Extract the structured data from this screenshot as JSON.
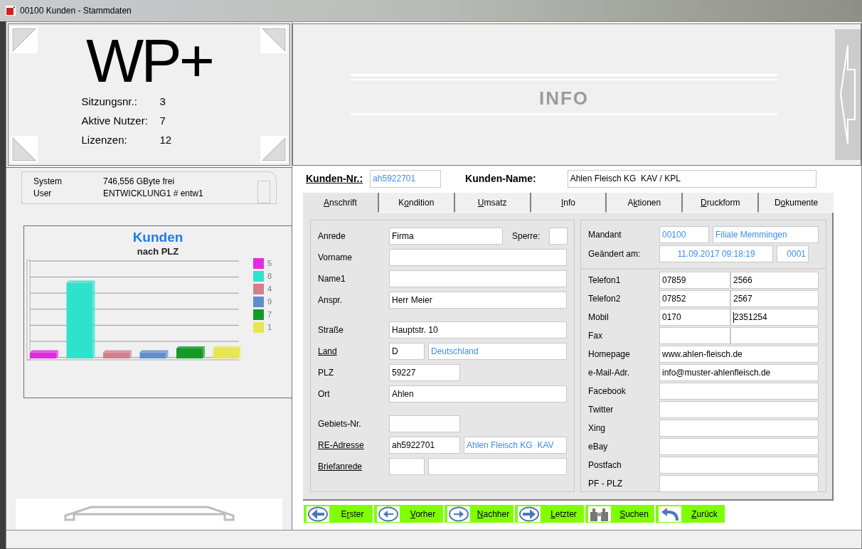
{
  "window": {
    "title": "00100 Kunden - Stammdaten"
  },
  "logo": {
    "text": "WP+",
    "stats": [
      {
        "label": "Sitzungsnr.:",
        "value": "3"
      },
      {
        "label": "Aktive Nutzer:",
        "value": "7"
      },
      {
        "label": "Lizenzen:",
        "value": "12"
      }
    ]
  },
  "system_info": [
    {
      "label": "System",
      "value": "746,556 GByte frei"
    },
    {
      "label": "User",
      "value": "ENTWICKLUNG1 # entw1"
    }
  ],
  "chart": {
    "title": "Kunden",
    "subtitle": "nach PLZ",
    "legend": [
      {
        "label": "5",
        "color": "#e628e6"
      },
      {
        "label": "8",
        "color": "#2ee3cc"
      },
      {
        "label": "4",
        "color": "#d17f8f"
      },
      {
        "label": "9",
        "color": "#5f8fcb"
      },
      {
        "label": "7",
        "color": "#159a2a"
      },
      {
        "label": "1",
        "color": "#e6e64f"
      }
    ]
  },
  "info_banner": {
    "text": "INFO"
  },
  "header": {
    "number_label": "Kunden-Nr.:",
    "number": "ah5922701",
    "name_label": "Kunden-Name:",
    "name": "Ahlen Fleisch KG  KAV / KPL"
  },
  "tabs": [
    {
      "label": "Anschrift",
      "selected": true
    },
    {
      "label": "Kondition",
      "selected": false
    },
    {
      "label": "Umsatz",
      "selected": false
    },
    {
      "label": "Info",
      "selected": false
    },
    {
      "label": "Aktionen",
      "selected": false
    },
    {
      "label": "Druckform",
      "selected": false
    },
    {
      "label": "Dokumente",
      "selected": false
    }
  ],
  "address_rows": [
    {
      "label": "Anrede",
      "link": false,
      "fields": [
        {
          "kind": "medium",
          "value": "Firma"
        },
        {
          "kind": "label",
          "text": "Sperre:"
        },
        {
          "kind": "check",
          "checked": false
        }
      ]
    },
    {
      "label": "Vorname",
      "link": false,
      "fields": [
        {
          "kind": "full"
        }
      ]
    },
    {
      "label": "Name1",
      "link": false,
      "fields": [
        {
          "kind": "full"
        }
      ]
    },
    {
      "label": "Anspr.",
      "link": false,
      "fields": [
        {
          "kind": "full",
          "value": "Herr Meier"
        }
      ]
    },
    {
      "label": "Straße",
      "link": false,
      "fields": [
        {
          "kind": "full",
          "value": "Hauptstr. 10"
        }
      ]
    },
    {
      "label": "Land",
      "link": true,
      "fields": [
        {
          "kind": "tiny",
          "value": "D"
        },
        {
          "kind": "rest",
          "value": "Deutschland",
          "readonly": true
        }
      ]
    },
    {
      "label": "PLZ",
      "link": false,
      "fields": [
        {
          "kind": "short",
          "value": "59227"
        }
      ]
    },
    {
      "label": "Ort",
      "link": false,
      "fields": [
        {
          "kind": "full",
          "value": "Ahlen"
        }
      ]
    },
    {
      "label": "Gebiets-Nr.",
      "link": false,
      "fields": [
        {
          "kind": "short"
        }
      ]
    },
    {
      "label": "RE-Adresse",
      "link": true,
      "fields": [
        {
          "kind": "short",
          "value": "ah5922701"
        },
        {
          "kind": "rest",
          "value": "Ahlen Fleisch KG  KAV",
          "readonly": true
        }
      ]
    },
    {
      "label": "Briefanrede",
      "link": true,
      "fields": [
        {
          "kind": "tiny"
        },
        {
          "kind": "rest"
        }
      ]
    }
  ],
  "meta_rows": [
    {
      "label": "Mandant",
      "fields": [
        {
          "kind": "code",
          "value": "00100",
          "readonly": true
        },
        {
          "kind": "rest",
          "value": "Filiale Memmingen",
          "readonly": true
        }
      ]
    },
    {
      "label": "Geändert am:",
      "fields": [
        {
          "kind": "date",
          "value": "11.09.2017 09:18:19",
          "readonly": true
        },
        {
          "kind": "counter",
          "value": "0001",
          "readonly": true
        }
      ]
    }
  ],
  "contact_rows": [
    {
      "label": "Telefon1",
      "fields": [
        {
          "kind": "area",
          "value": "07859"
        },
        {
          "kind": "rest",
          "value": "2566"
        }
      ]
    },
    {
      "label": "Telefon2",
      "fields": [
        {
          "kind": "area",
          "value": "07852"
        },
        {
          "kind": "rest",
          "value": "2567"
        }
      ]
    },
    {
      "label": "Mobil",
      "fields": [
        {
          "kind": "area",
          "value": "0170"
        },
        {
          "kind": "rest",
          "value": "2351254",
          "focused": true
        }
      ]
    },
    {
      "label": "Fax",
      "fields": [
        {
          "kind": "area"
        },
        {
          "kind": "rest"
        }
      ]
    },
    {
      "label": "Homepage",
      "fields": [
        {
          "kind": "rest",
          "value": "www.ahlen-fleisch.de"
        }
      ]
    },
    {
      "label": "e-Mail-Adr.",
      "fields": [
        {
          "kind": "rest",
          "value": "info@muster-ahlenfleisch.de"
        }
      ]
    },
    {
      "label": "Facebook",
      "fields": [
        {
          "kind": "rest"
        }
      ]
    },
    {
      "label": "Twitter",
      "fields": [
        {
          "kind": "rest"
        }
      ]
    },
    {
      "label": "Xing",
      "fields": [
        {
          "kind": "rest"
        }
      ]
    },
    {
      "label": "eBay",
      "fields": [
        {
          "kind": "rest"
        }
      ]
    },
    {
      "label": "Postfach",
      "fields": [
        {
          "kind": "rest"
        }
      ]
    },
    {
      "label": "PF - PLZ",
      "fields": [
        {
          "kind": "rest"
        }
      ]
    }
  ],
  "nav_buttons": [
    {
      "label": "Erster",
      "kind": "first"
    },
    {
      "label": "Vorher",
      "kind": "prev"
    },
    {
      "label": "Nachher",
      "kind": "next"
    },
    {
      "label": "Letzter",
      "kind": "last"
    },
    {
      "label": "Suchen",
      "kind": "search"
    },
    {
      "label": "Zurück",
      "kind": "back"
    }
  ]
}
